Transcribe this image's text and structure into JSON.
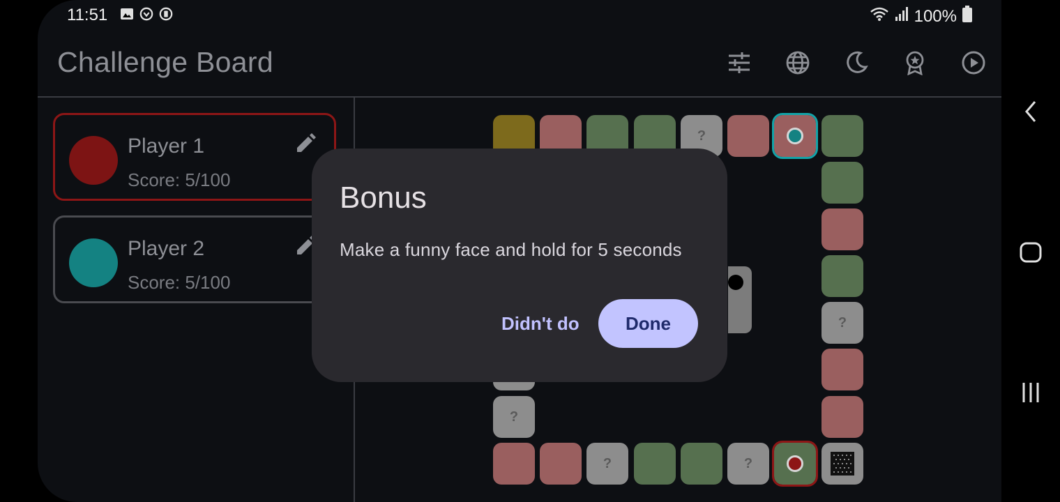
{
  "status_bar": {
    "time": "11:51",
    "left_icons": [
      "image-icon",
      "sync-icon",
      "clipboard-icon"
    ],
    "battery": "100%"
  },
  "app_bar": {
    "title": "Challenge Board",
    "actions": [
      {
        "name": "settings-sliders-icon"
      },
      {
        "name": "globe-icon"
      },
      {
        "name": "moon-icon"
      },
      {
        "name": "award-icon"
      },
      {
        "name": "play-icon"
      }
    ]
  },
  "players": [
    {
      "name": "Player 1",
      "score": "Score: 5/100",
      "color": "#7d1414",
      "border": "#8d1616"
    },
    {
      "name": "Player 2",
      "score": "Score: 5/100",
      "color": "#148282",
      "border": "#4a4b50"
    }
  ],
  "board": {
    "cell_colors": {
      "yellow": "#7d6a1c",
      "pink": "#9a5f5f",
      "green": "#56704f",
      "gray": "#8d8d8d"
    },
    "question_mark": "?"
  },
  "dialog": {
    "title": "Bonus",
    "body": "Make a funny face and hold for 5 seconds",
    "secondary_button": "Didn't do",
    "primary_button": "Done"
  },
  "nav_bar": {
    "buttons": [
      "back-icon",
      "home-icon",
      "recents-icon"
    ]
  }
}
